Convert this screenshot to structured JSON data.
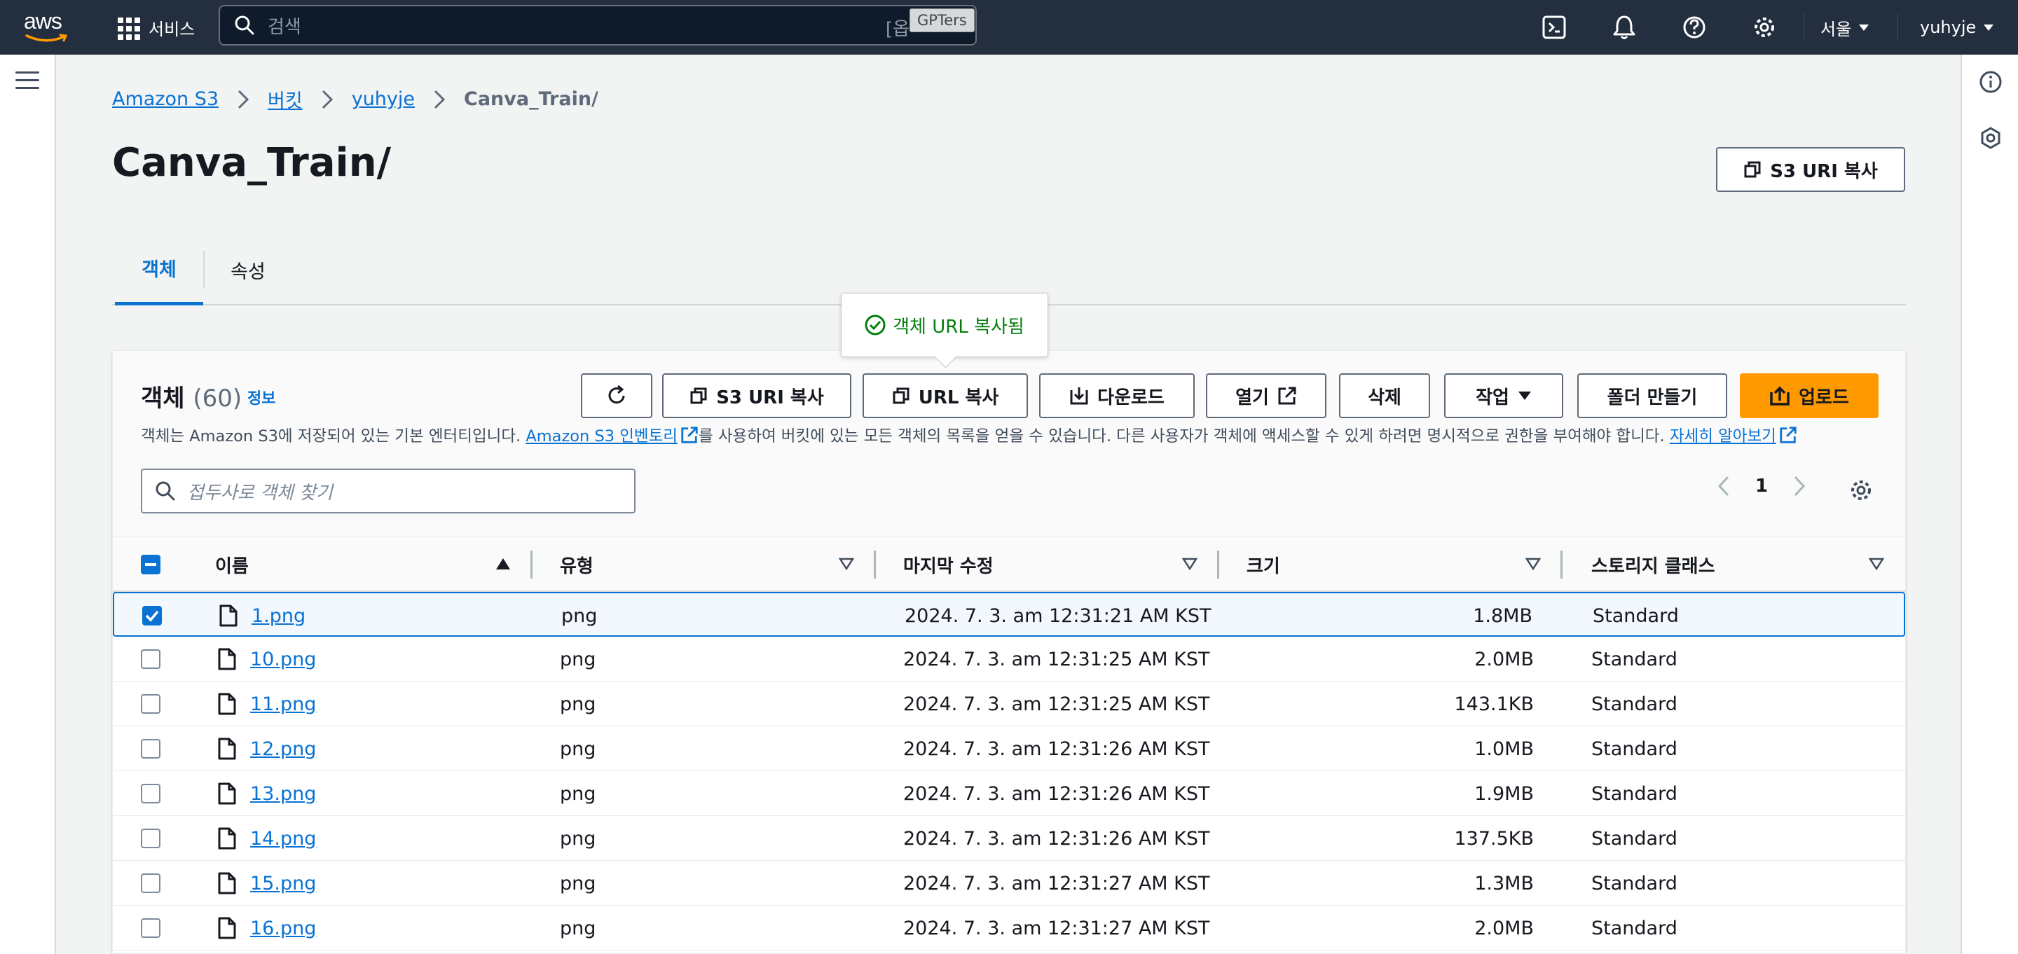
{
  "topnav": {
    "logo_text": "aws",
    "services_label": "서비스",
    "search_placeholder": "검색",
    "search_shortcut": "[옵",
    "overlay_badge": "GPTers",
    "region_label": "서울",
    "user_label": "yuhyje"
  },
  "breadcrumb": {
    "items": [
      "Amazon S3",
      "버킷",
      "yuhyje"
    ],
    "current": "Canva_Train/"
  },
  "page": {
    "title": "Canva_Train/",
    "copy_s3_uri_label": "S3 URI 복사"
  },
  "tabs": {
    "objects": "객체",
    "properties": "속성"
  },
  "tooltip": {
    "text": "객체 URL 복사됨"
  },
  "panel": {
    "title": "객체",
    "count": "(60)",
    "info_link": "정보",
    "desc_1": "객체는 Amazon S3에 저장되어 있는 기본 엔터티입니다. ",
    "desc_link_1": "Amazon S3 인벤토리",
    "desc_2": "를 사용하여 버킷에 있는 모든 객체의 목록을 얻을 수 있습니다. 다른 사용자가 객체에 액세스할 수 있게 하려면 명시적으로 권한을 부여해야 합니다. ",
    "desc_link_2": "자세히 알아보기",
    "toolbar": {
      "s3uri": "S3 URI 복사",
      "url": "URL 복사",
      "download": "다운로드",
      "open": "열기",
      "delete": "삭제",
      "action": "작업",
      "create_folder": "폴더 만들기",
      "upload": "업로드"
    },
    "filter_placeholder": "접두사로 객체 찾기",
    "page_number": "1"
  },
  "table": {
    "columns": [
      "이름",
      "유형",
      "마지막 수정",
      "크기",
      "스토리지 클래스"
    ],
    "rows": [
      {
        "name": "1.png",
        "type": "png",
        "modified": "2024. 7. 3. am 12:31:21 AM KST",
        "size": "1.8MB",
        "class": "Standard",
        "checked": true
      },
      {
        "name": "10.png",
        "type": "png",
        "modified": "2024. 7. 3. am 12:31:25 AM KST",
        "size": "2.0MB",
        "class": "Standard",
        "checked": false
      },
      {
        "name": "11.png",
        "type": "png",
        "modified": "2024. 7. 3. am 12:31:25 AM KST",
        "size": "143.1KB",
        "class": "Standard",
        "checked": false
      },
      {
        "name": "12.png",
        "type": "png",
        "modified": "2024. 7. 3. am 12:31:26 AM KST",
        "size": "1.0MB",
        "class": "Standard",
        "checked": false
      },
      {
        "name": "13.png",
        "type": "png",
        "modified": "2024. 7. 3. am 12:31:26 AM KST",
        "size": "1.9MB",
        "class": "Standard",
        "checked": false
      },
      {
        "name": "14.png",
        "type": "png",
        "modified": "2024. 7. 3. am 12:31:26 AM KST",
        "size": "137.5KB",
        "class": "Standard",
        "checked": false
      },
      {
        "name": "15.png",
        "type": "png",
        "modified": "2024. 7. 3. am 12:31:27 AM KST",
        "size": "1.3MB",
        "class": "Standard",
        "checked": false
      },
      {
        "name": "16.png",
        "type": "png",
        "modified": "2024. 7. 3. am 12:31:27 AM KST",
        "size": "2.0MB",
        "class": "Standard",
        "checked": false
      }
    ]
  },
  "colors": {
    "nav_bg": "#232f3e",
    "link": "#0972d3",
    "upload": "#ff9900",
    "success": "#037f0c"
  }
}
